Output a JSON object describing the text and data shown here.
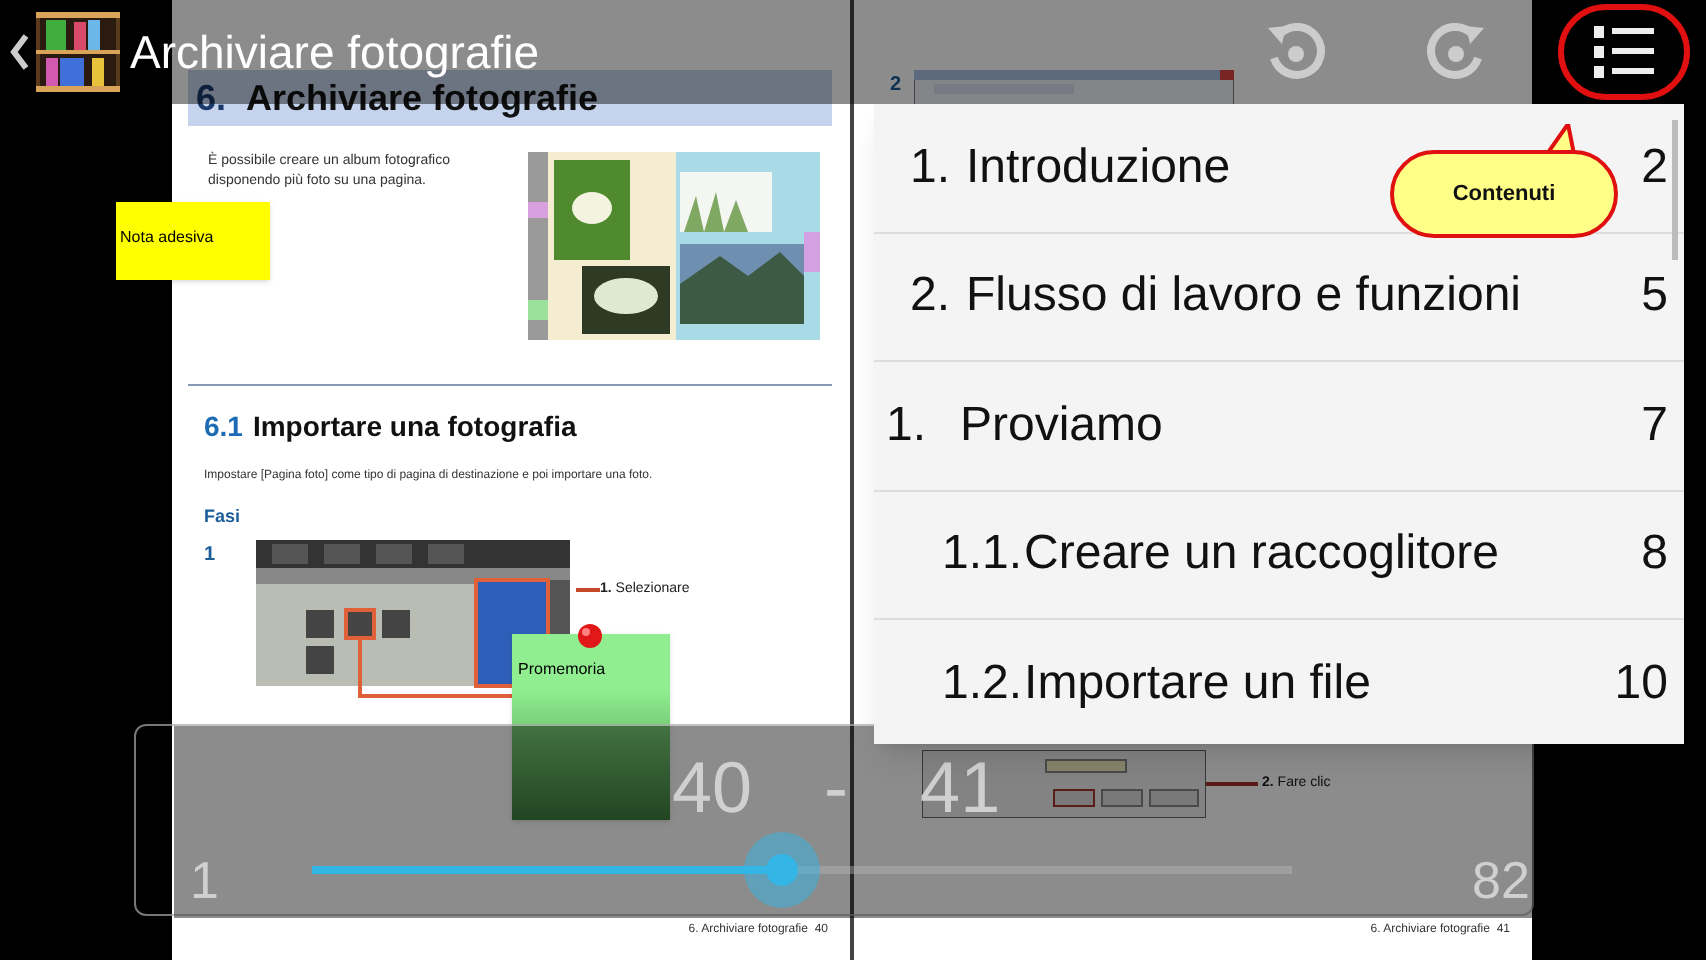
{
  "header": {
    "title": "Archiviare fotografie"
  },
  "left_page": {
    "chapter_number": "6.",
    "chapter_title": "Archiviare fotografie",
    "intro": "È possibile creare un album fotografico disponendo più foto su una pagina.",
    "section_number": "6.1",
    "section_title": "Importare una fotografia",
    "section_text": "Impostare [Pagina foto] come tipo di pagina di destinazione e poi importare una foto.",
    "steps_heading": "Fasi",
    "step_number": "1",
    "callout": "**1.** Selezionare",
    "footer": "6. Archiviare fotografie  40"
  },
  "right_page": {
    "step_number": "2",
    "callout": "**2.** Fare clic",
    "footer": "6. Archiviare fotografie  41"
  },
  "notes": [
    {
      "kind": "sticky",
      "text": "Nota adesiva",
      "color": "#ffff00"
    },
    {
      "kind": "pinned",
      "text": "Promemoria",
      "color": "#90ee90"
    }
  ],
  "toc": {
    "items": [
      {
        "number": "1.",
        "title": "Introduzione",
        "page": "2"
      },
      {
        "number": "2.",
        "title": "Flusso di lavoro e funzioni",
        "page": "5"
      },
      {
        "number": "1.",
        "title": "Proviamo",
        "page": "7",
        "children": [
          {
            "number": "1.1.",
            "title": "Creare un raccoglitore",
            "page": "8"
          },
          {
            "number": "1.2.",
            "title": "Importare un file",
            "page": "10"
          }
        ]
      }
    ]
  },
  "callout_bubble": "Contenuti",
  "slider": {
    "current_start": "40",
    "separator": "-",
    "current_end": "41",
    "min": "1",
    "max": "82",
    "level": 0.48
  }
}
